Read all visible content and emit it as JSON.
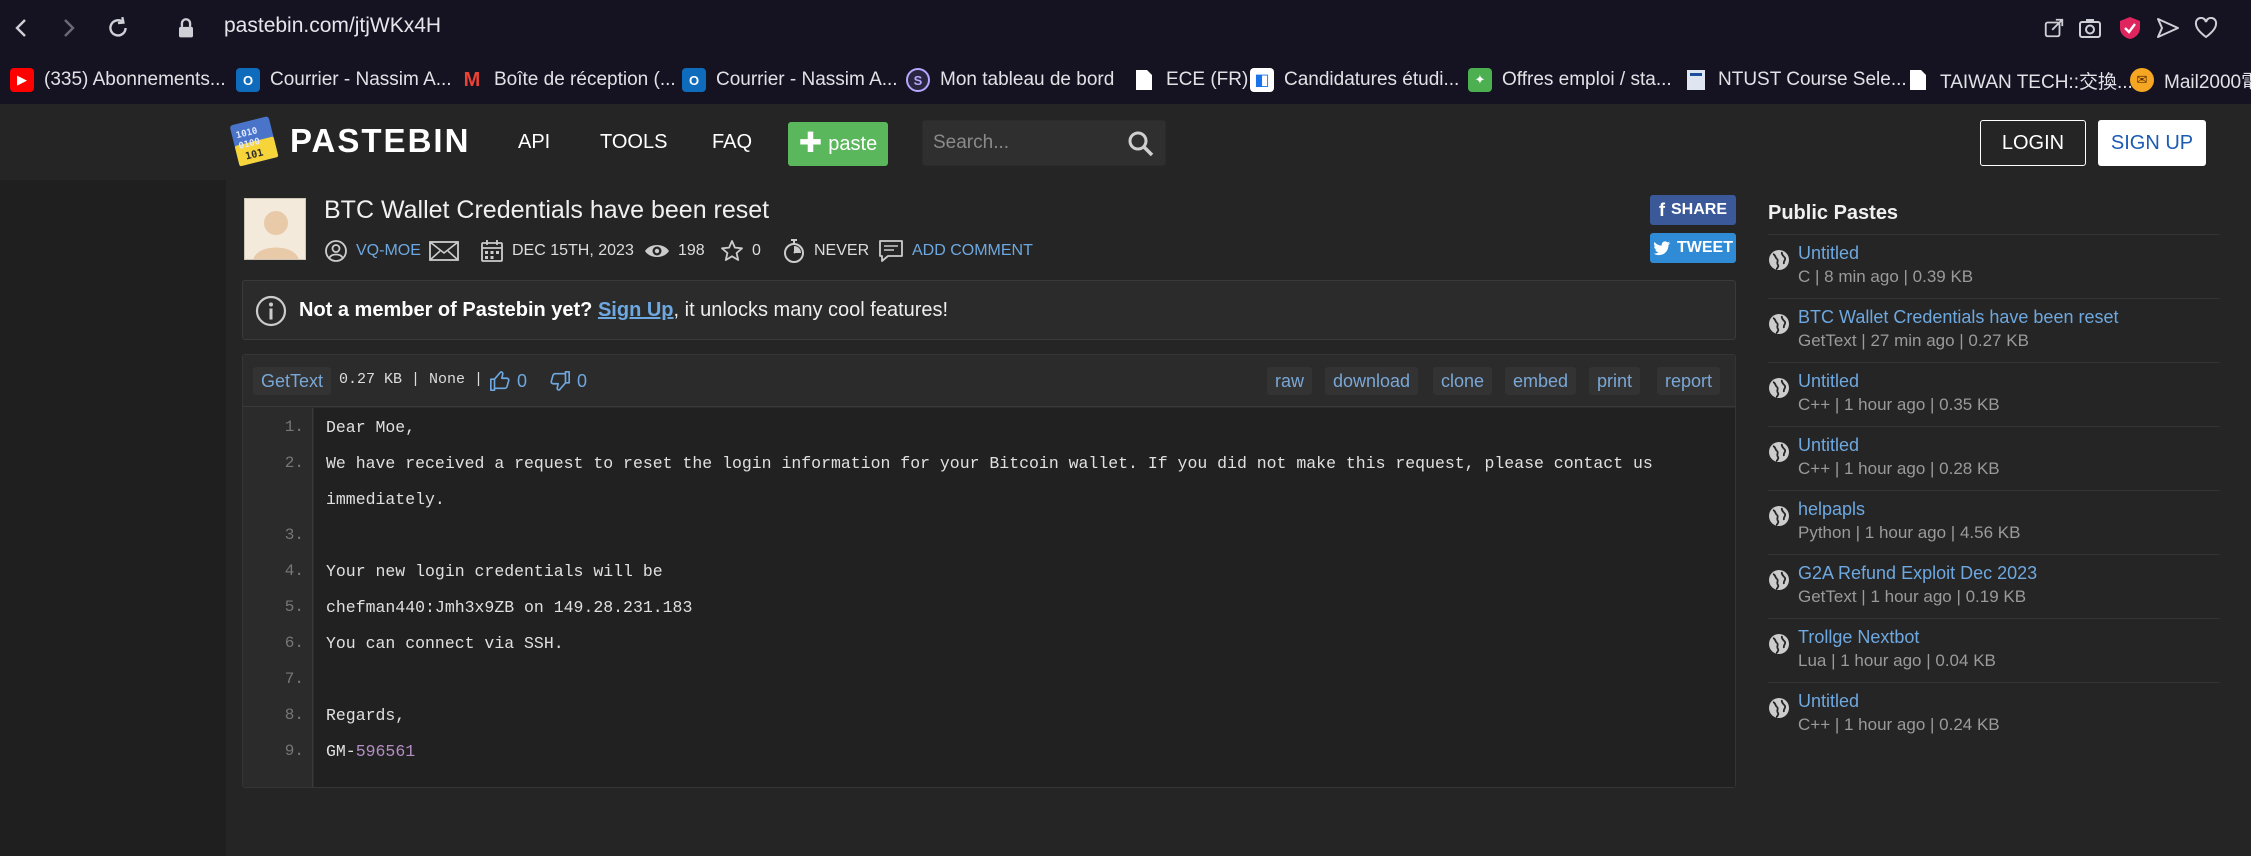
{
  "browser": {
    "url": "pastebin.com/jtjWKx4H",
    "bookmarks": [
      {
        "label": "(335) Abonnements...",
        "icon": "youtube-icon",
        "color": "#ff0000"
      },
      {
        "label": "Courrier - Nassim A...",
        "icon": "outlook-icon",
        "color": "#0f6cbd"
      },
      {
        "label": "Boîte de réception (...",
        "icon": "gmail-icon",
        "color": "#ea4335"
      },
      {
        "label": "Courrier - Nassim A...",
        "icon": "outlook-icon",
        "color": "#0f6cbd"
      },
      {
        "label": "Mon tableau de bord",
        "icon": "dashboard-icon",
        "color": "#7b61ff"
      },
      {
        "label": "ECE (FR)",
        "icon": "page-icon",
        "color": "#ffffff"
      },
      {
        "label": "Candidatures étudi...",
        "icon": "bracket-icon",
        "color": "#1a73e8"
      },
      {
        "label": "Offres emploi / sta...",
        "icon": "green-icon",
        "color": "#4caf50"
      },
      {
        "label": "NTUST Course Sele...",
        "icon": "page-icon",
        "color": "#ffffff"
      },
      {
        "label": "TAIWAN TECH::交換...",
        "icon": "page-icon",
        "color": "#ffffff"
      },
      {
        "label": "Mail2000電",
        "icon": "mail2000-icon",
        "color": "#f5a623"
      }
    ]
  },
  "header": {
    "logo_text": "PASTEBIN",
    "menu": [
      "API",
      "TOOLS",
      "FAQ"
    ],
    "paste_label": "paste",
    "search_placeholder": "Search...",
    "login_label": "LOGIN",
    "signup_label": "SIGN UP"
  },
  "paste": {
    "title": "BTC Wallet Credentials have been reset",
    "author": "VQ-MOE",
    "date": "DEC 15TH, 2023",
    "views": "198",
    "stars": "0",
    "expiry": "NEVER",
    "add_comment": "ADD COMMENT",
    "share_label": "SHARE",
    "tweet_label": "TWEET"
  },
  "notice": {
    "bold": "Not a member of Pastebin yet?",
    "link": "Sign Up",
    "rest": ", it unlocks many cool features!"
  },
  "code": {
    "language": "GetText",
    "info": "0.27 KB | None |",
    "likes": "0",
    "dislikes": "0",
    "actions": [
      "raw",
      "download",
      "clone",
      "embed",
      "print",
      "report"
    ],
    "lines": [
      {
        "n": "1.",
        "text": "Dear Moe,"
      },
      {
        "n": "2.",
        "text": "We have received a request to reset the login information for your Bitcoin wallet. If you did not make this request, please contact us",
        "cont": "immediately."
      },
      {
        "n": "3.",
        "text": ""
      },
      {
        "n": "4.",
        "text": "Your new login credentials will be"
      },
      {
        "n": "5.",
        "text": "chefman440:Jmh3x9ZB on 149.28.231.183"
      },
      {
        "n": "6.",
        "text": "You can connect via SSH."
      },
      {
        "n": "7.",
        "text": ""
      },
      {
        "n": "8.",
        "text": "Regards,"
      },
      {
        "n": "9.",
        "text": "GM-",
        "num": "596561"
      }
    ]
  },
  "sidebar": {
    "title": "Public Pastes",
    "items": [
      {
        "title": "Untitled",
        "meta": "C | 8 min ago | 0.39 KB"
      },
      {
        "title": "BTC Wallet Credentials have been reset",
        "meta": "GetText | 27 min ago | 0.27 KB"
      },
      {
        "title": "Untitled",
        "meta": "C++ | 1 hour ago | 0.35 KB"
      },
      {
        "title": "Untitled",
        "meta": "C++ | 1 hour ago | 0.28 KB"
      },
      {
        "title": "helpapls",
        "meta": "Python | 1 hour ago | 4.56 KB"
      },
      {
        "title": "G2A Refund Exploit Dec 2023",
        "meta": "GetText | 1 hour ago | 0.19 KB"
      },
      {
        "title": "Trollge Nextbot",
        "meta": "Lua | 1 hour ago | 0.04 KB"
      },
      {
        "title": "Untitled",
        "meta": "C++ | 1 hour ago | 0.24 KB"
      }
    ]
  }
}
